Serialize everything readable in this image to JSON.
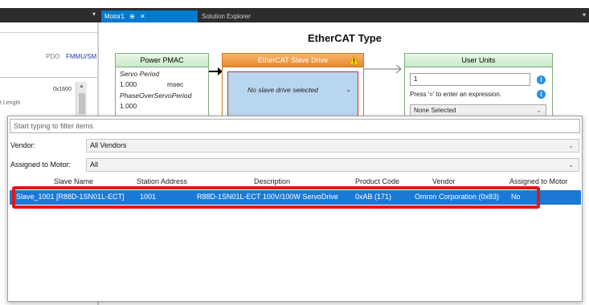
{
  "tabs": {
    "active_label": "Motor1",
    "active_pin": "⊕",
    "active_close": "✕",
    "inactive_label": "Solution Explorer",
    "menu_arrow": "▾",
    "left_arrow": "▾"
  },
  "left_panel": {
    "pdo": "PDO",
    "fmmu": "FMMU/SM",
    "hex": "0x1600",
    "length_label": "t Length",
    "scroll_up": "▲"
  },
  "diagram": {
    "title": "EtherCAT Type",
    "pmac": {
      "header": "Power PMAC",
      "servo_period_label": "Servo Period",
      "servo_period_value": "1.000",
      "servo_period_unit": "msec",
      "phase_label": "PhaseOverServoPeriod",
      "phase_value": "1.000"
    },
    "ecat": {
      "header": "EtherCAT Slave Drive",
      "placeholder": "No slave drive selected",
      "chevron": "⌄",
      "warning_icon": "warning-icon"
    },
    "units": {
      "header": "User Units",
      "input_value": "1",
      "hint": "Press '=' to enter an expression.",
      "select_value": "None Selected",
      "select_chevron": "⌄",
      "info_glyph": "i"
    }
  },
  "popup": {
    "filter_placeholder": "Start typing to filter items",
    "vendor_label": "Vendor:",
    "vendor_value": "All Vendors",
    "assigned_label": "Assigned to Motor:",
    "assigned_value": "All",
    "combo_chevron": "⌄",
    "columns": [
      "Slave Name",
      "Station Address",
      "Description",
      "Product Code",
      "Vendor",
      "Assigned to Motor"
    ],
    "rows": [
      {
        "name": "Slave_1001 [R88D-1SN01L-ECT]",
        "station": "1001",
        "description": "R88D-1SN01L-ECT 100V/100W ServoDrive",
        "product_code": "0xAB (171)",
        "vendor": "Omron Corporation (0x83)",
        "assigned": "No"
      }
    ]
  },
  "colors": {
    "accent": "#007acc",
    "selection": "#1b79d6",
    "highlight": "#e3151a",
    "green_header": "#c9e9c9",
    "orange_header": "#e8872e"
  }
}
